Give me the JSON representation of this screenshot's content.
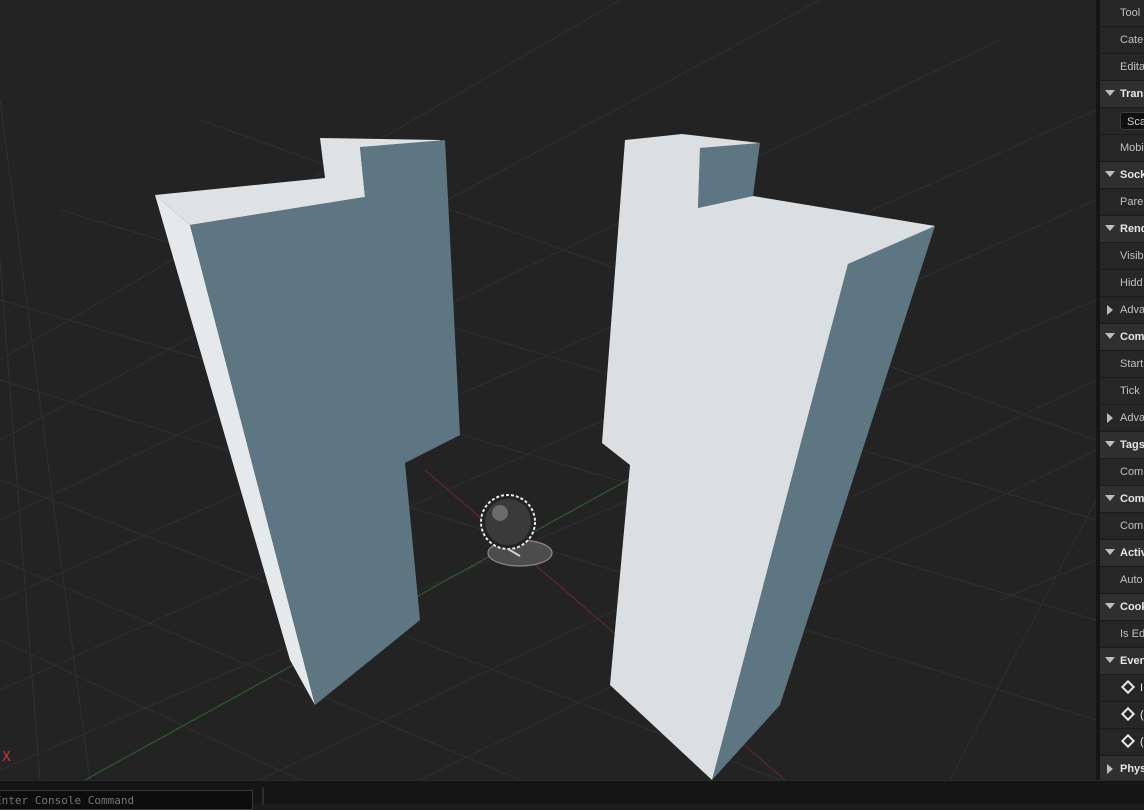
{
  "viewport": {
    "axis_label": "X"
  },
  "details_panel": {
    "rows": [
      {
        "kind": "prop",
        "label": "Tool"
      },
      {
        "kind": "prop",
        "label": "Cate"
      },
      {
        "kind": "prop",
        "label": "Edita"
      },
      {
        "kind": "cat",
        "label": "Trans",
        "expanded": true
      },
      {
        "kind": "combo",
        "label": "Sca"
      },
      {
        "kind": "prop",
        "label": "Mobi"
      },
      {
        "kind": "cat",
        "label": "Sock",
        "expanded": true
      },
      {
        "kind": "prop",
        "label": "Pare"
      },
      {
        "kind": "cat",
        "label": "Rend",
        "expanded": true
      },
      {
        "kind": "prop",
        "label": "Visib"
      },
      {
        "kind": "prop",
        "label": "Hidd"
      },
      {
        "kind": "prop",
        "label": "Adva",
        "expandable": true
      },
      {
        "kind": "cat",
        "label": "Com",
        "expanded": true
      },
      {
        "kind": "prop",
        "label": "Start"
      },
      {
        "kind": "prop",
        "label": "Tick"
      },
      {
        "kind": "prop",
        "label": "Adva",
        "expandable": true
      },
      {
        "kind": "cat",
        "label": "Tags",
        "expanded": true
      },
      {
        "kind": "prop",
        "label": "Com"
      },
      {
        "kind": "cat",
        "label": "Com",
        "expanded": true
      },
      {
        "kind": "prop",
        "label": "Com"
      },
      {
        "kind": "cat",
        "label": "Activ",
        "expanded": true
      },
      {
        "kind": "prop",
        "label": "Auto"
      },
      {
        "kind": "cat",
        "label": "Cook",
        "expanded": true
      },
      {
        "kind": "prop",
        "label": "Is Ed"
      },
      {
        "kind": "cat",
        "label": "Even",
        "expanded": true
      },
      {
        "kind": "event",
        "label": "I"
      },
      {
        "kind": "event",
        "label": "("
      },
      {
        "kind": "event",
        "label": "("
      },
      {
        "kind": "cat",
        "label": "Phys",
        "expanded": false
      }
    ]
  },
  "console": {
    "placeholder": "Enter Console Command"
  }
}
